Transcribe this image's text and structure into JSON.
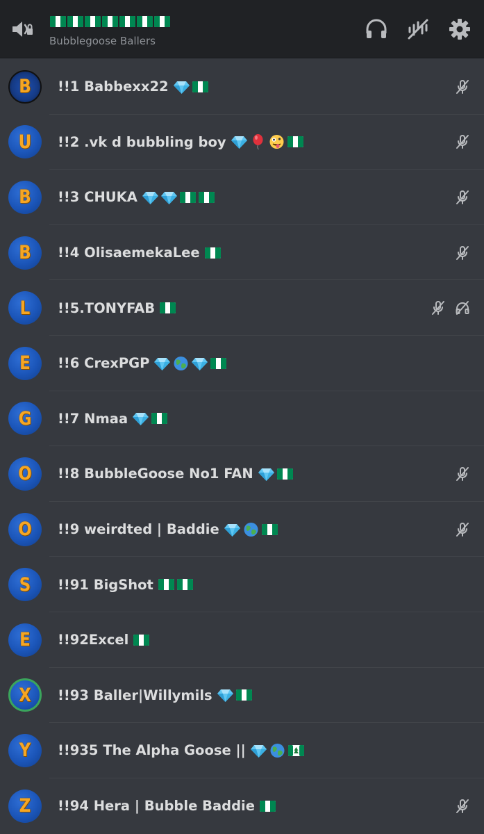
{
  "header": {
    "title_flag_count": 7,
    "subtitle": "Bubblegoose Ballers",
    "icons": [
      "speaker-icon",
      "headphones-icon",
      "microphone-muted-icon",
      "settings-icon"
    ]
  },
  "colors": {
    "background": "#36393f",
    "header": "#202225",
    "avatar_blue": "#1b55b8",
    "avatar_letter": "#f6a623",
    "ring_green": "#3ba55c",
    "icon_grey": "#b9bbbe"
  },
  "members": [
    {
      "name": "!!1 Babbexx22",
      "letter": "B",
      "emojis": [
        "diamond",
        "flag"
      ],
      "muted": true,
      "deafened": false,
      "avatar_style": "dark"
    },
    {
      "name": "!!2 .vk d bubbling boy",
      "letter": "U",
      "emojis": [
        "diamond",
        "balloon",
        "zany-face",
        "flag"
      ],
      "muted": true,
      "deafened": false,
      "avatar_style": "plain"
    },
    {
      "name": "!!3 CHUKA",
      "letter": "B",
      "emojis": [
        "diamond",
        "diamond",
        "flag",
        "flag"
      ],
      "muted": true,
      "deafened": false,
      "avatar_style": "plain"
    },
    {
      "name": "!!4 OlisaemekaLee",
      "letter": "B",
      "emojis": [
        "flag"
      ],
      "muted": true,
      "deafened": false,
      "avatar_style": "plain"
    },
    {
      "name": "!!5.TONYFAB",
      "letter": "L",
      "emojis": [
        "flag"
      ],
      "muted": true,
      "deafened": true,
      "avatar_style": "plain"
    },
    {
      "name": "!!6 CrexPGP",
      "letter": "E",
      "emojis": [
        "diamond",
        "globe",
        "diamond",
        "flag"
      ],
      "muted": false,
      "deafened": false,
      "avatar_style": "plain"
    },
    {
      "name": "!!7 Nmaa",
      "letter": "G",
      "emojis": [
        "diamond",
        "flag"
      ],
      "muted": false,
      "deafened": false,
      "avatar_style": "plain"
    },
    {
      "name": "!!8 BubbleGoose No1 FAN",
      "letter": "O",
      "emojis": [
        "diamond",
        "flag"
      ],
      "muted": true,
      "deafened": false,
      "avatar_style": "plain"
    },
    {
      "name": "!!9 weirdted | Baddie",
      "letter": "O",
      "emojis": [
        "diamond",
        "globe",
        "flag"
      ],
      "muted": true,
      "deafened": false,
      "avatar_style": "plain"
    },
    {
      "name": "!!91 BigShot",
      "letter": "S",
      "emojis": [
        "flag",
        "flag"
      ],
      "muted": false,
      "deafened": false,
      "avatar_style": "plain"
    },
    {
      "name": "!!92Excel",
      "letter": "E",
      "emojis": [
        "flag"
      ],
      "muted": false,
      "deafened": false,
      "avatar_style": "plain"
    },
    {
      "name": "!!93 Baller|Willymils",
      "letter": "X",
      "emojis": [
        "diamond",
        "flag"
      ],
      "muted": false,
      "deafened": false,
      "avatar_style": "ring"
    },
    {
      "name": "!!935 The Alpha Goose ||",
      "letter": "Y",
      "emojis": [
        "diamond",
        "globe",
        "tree-flag"
      ],
      "muted": false,
      "deafened": false,
      "avatar_style": "plain"
    },
    {
      "name": "!!94 Hera | Bubble Baddie",
      "letter": "Z",
      "emojis": [
        "flag"
      ],
      "muted": true,
      "deafened": false,
      "avatar_style": "plain"
    }
  ]
}
